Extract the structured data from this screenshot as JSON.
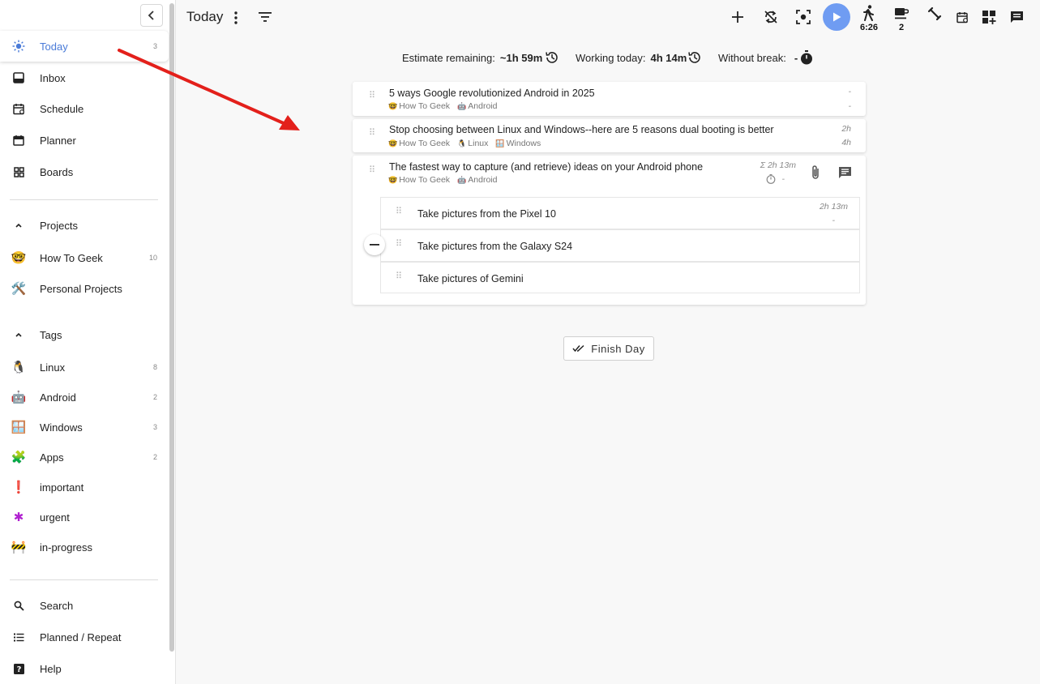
{
  "sidebar": {
    "items": [
      {
        "label": "Today",
        "count": "3",
        "icon": "sun-icon"
      },
      {
        "label": "Inbox",
        "count": "",
        "icon": "inbox-icon"
      },
      {
        "label": "Schedule",
        "count": "",
        "icon": "schedule-icon"
      },
      {
        "label": "Planner",
        "count": "",
        "icon": "calendar-icon"
      },
      {
        "label": "Boards",
        "count": "",
        "icon": "boards-icon"
      }
    ],
    "projects_header": "Projects",
    "projects": [
      {
        "label": "How To Geek",
        "count": "10",
        "emoji": "🤓"
      },
      {
        "label": "Personal Projects",
        "count": "",
        "emoji": "🛠️"
      }
    ],
    "tags_header": "Tags",
    "tags": [
      {
        "label": "Linux",
        "count": "8",
        "emoji": "🐧"
      },
      {
        "label": "Android",
        "count": "2",
        "emoji": "🤖"
      },
      {
        "label": "Windows",
        "count": "3",
        "emoji": "🪟"
      },
      {
        "label": "Apps",
        "count": "2",
        "emoji": "🧩"
      },
      {
        "label": "important",
        "count": "",
        "emoji": "❗"
      },
      {
        "label": "urgent",
        "count": "",
        "emoji": "✱"
      },
      {
        "label": "in-progress",
        "count": "",
        "emoji": "🚧"
      }
    ],
    "bottom": [
      {
        "label": "Search",
        "icon": "search-icon"
      },
      {
        "label": "Planned / Repeat",
        "icon": "list-icon"
      },
      {
        "label": "Help",
        "icon": "help-icon"
      }
    ]
  },
  "header": {
    "title": "Today",
    "walk_time": "6:26",
    "coffee_count": "2",
    "accent_color": "#6f9cf2"
  },
  "stats": {
    "estimate_label": "Estimate remaining:",
    "estimate_value": "~1h 59m",
    "working_label": "Working today:",
    "working_value": "4h 14m",
    "break_label": "Without break:",
    "break_value": "-"
  },
  "tasks": [
    {
      "title": "5 ways Google revolutionized Android in 2025",
      "tags": [
        {
          "emoji": "🤓",
          "label": "How To Geek"
        },
        {
          "emoji": "🤖",
          "label": "Android"
        }
      ],
      "time_spent": "-",
      "time_estimate": "-"
    },
    {
      "title": "Stop choosing between Linux and Windows--here are 5 reasons dual booting is better",
      "tags": [
        {
          "emoji": "🤓",
          "label": "How To Geek"
        },
        {
          "emoji": "🐧",
          "label": "Linux"
        },
        {
          "emoji": "🪟",
          "label": "Windows"
        }
      ],
      "time_spent": "2h",
      "time_estimate": "4h"
    },
    {
      "title": "The fastest way to capture (and retrieve) ideas on your Android phone",
      "tags": [
        {
          "emoji": "🤓",
          "label": "How To Geek"
        },
        {
          "emoji": "🤖",
          "label": "Android"
        }
      ],
      "time_spent": "Σ 2h 13m",
      "time_estimate": "-",
      "subtasks": [
        {
          "title": "Take pictures from the Pixel 10",
          "time_spent": "2h 13m",
          "time_estimate": "-"
        },
        {
          "title": "Take pictures from the Galaxy S24"
        },
        {
          "title": "Take pictures of Gemini"
        }
      ]
    }
  ],
  "finish_day_label": "Finish Day"
}
